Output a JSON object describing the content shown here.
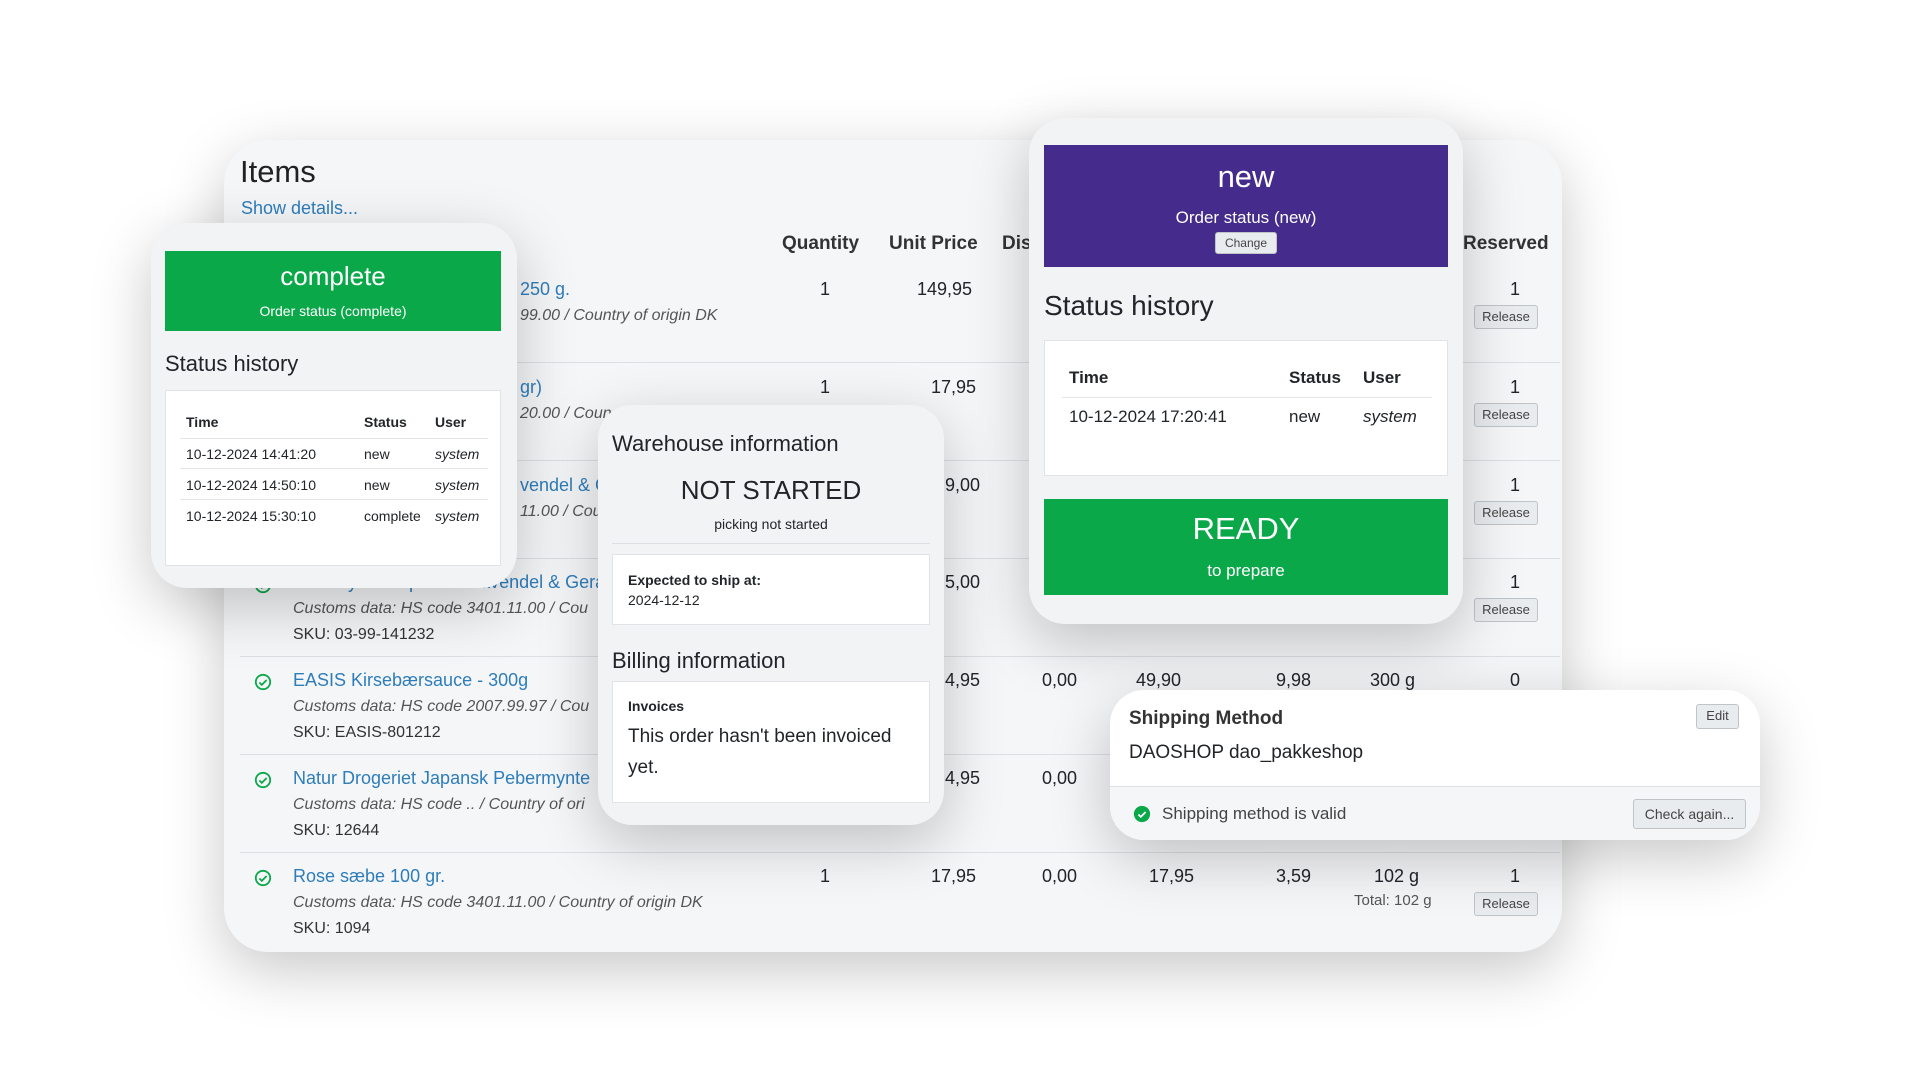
{
  "items": {
    "title": "Items",
    "show_details": "Show details...",
    "headers": {
      "quantity": "Quantity",
      "unit_price": "Unit Price",
      "discount": "Dis",
      "reserved": "Reserved"
    },
    "rows": [
      {
        "name": "250 g.",
        "customs": "99.00 / Country of origin DK",
        "sku": "",
        "qty": "1",
        "unit_price": "149,95",
        "discount": "",
        "price": "",
        "vat": "",
        "weight": "",
        "reserved": "1",
        "release": "Release"
      },
      {
        "name": "gr)",
        "customs": "20.00 / Coun",
        "sku": "",
        "qty": "1",
        "unit_price": "17,95",
        "discount": "",
        "price": "",
        "vat": "",
        "weight": "",
        "reserved": "1",
        "release": "Release"
      },
      {
        "name": "vendel & G",
        "customs": "11.00 / Cour",
        "sku": "",
        "qty": "",
        "unit_price": "9,00",
        "discount": "",
        "price": "",
        "vat": "",
        "weight": "",
        "reserved": "1",
        "release": "Release"
      },
      {
        "name": "Friendly Shampoobar Lavendel & Geranium",
        "customs": "Customs data: HS code 3401.11.00 / Cou",
        "sku": "SKU: 03-99-141232",
        "qty": "",
        "unit_price": "5,00",
        "discount": "",
        "price": "",
        "vat": "",
        "weight": "",
        "reserved": "1",
        "release": "Release"
      },
      {
        "name": "EASIS Kirsebærsauce - 300g",
        "customs": "Customs data: HS code 2007.99.97 / Cou",
        "sku": "SKU: EASIS-801212",
        "qty": "",
        "unit_price": "4,95",
        "discount": "0,00",
        "price": "49,90",
        "vat": "9,98",
        "weight": "300 g",
        "reserved": "0",
        "release": ""
      },
      {
        "name": "Natur Drogeriet Japansk Pebermynte",
        "customs": "Customs data: HS code .. / Country of ori",
        "sku": "SKU: 12644",
        "qty": "",
        "unit_price": "4,95",
        "discount": "0,00",
        "price": "",
        "vat": "",
        "weight": "",
        "reserved": "",
        "release": ""
      },
      {
        "name": "Rose sæbe 100 gr.",
        "customs": "Customs data: HS code 3401.11.00 / Country of origin DK",
        "sku": "SKU: 1094",
        "qty": "1",
        "unit_price": "17,95",
        "discount": "0,00",
        "price": "17,95",
        "vat": "3,59",
        "weight": "102 g",
        "reserved": "1",
        "release": "Release"
      }
    ],
    "total_weight": "Total: 102 g"
  },
  "complete_card": {
    "status": "complete",
    "subtitle": "Order status (complete)",
    "history_title": "Status history",
    "cols": {
      "time": "Time",
      "status": "Status",
      "user": "User"
    },
    "rows": [
      {
        "time": "10-12-2024 14:41:20",
        "status": "new",
        "user": "system"
      },
      {
        "time": "10-12-2024 14:50:10",
        "status": "new",
        "user": "system"
      },
      {
        "time": "10-12-2024 15:30:10",
        "status": "complete",
        "user": "system"
      }
    ]
  },
  "new_card": {
    "status": "new",
    "subtitle": "Order status (new)",
    "change": "Change",
    "history_title": "Status history",
    "cols": {
      "time": "Time",
      "status": "Status",
      "user": "User"
    },
    "rows": [
      {
        "time": "10-12-2024 17:20:41",
        "status": "new",
        "user": "system"
      }
    ],
    "ready_title": "READY",
    "ready_sub": "to prepare"
  },
  "warehouse": {
    "title": "Warehouse information",
    "state": "NOT STARTED",
    "state_sub": "picking not started",
    "ship_label": "Expected to ship at:",
    "ship_date": "2024-12-12",
    "billing_title": "Billing information",
    "invoices_label": "Invoices",
    "invoices_text_1": "This order hasn't been invoiced",
    "invoices_text_2": "yet."
  },
  "shipping": {
    "title": "Shipping Method",
    "edit": "Edit",
    "method": "DAOSHOP dao_pakkeshop",
    "valid_text": "Shipping method is valid",
    "check_again": "Check again..."
  },
  "colors": {
    "green": "#0ba84a",
    "purple": "#452c8c",
    "link": "#2e7dbb"
  }
}
